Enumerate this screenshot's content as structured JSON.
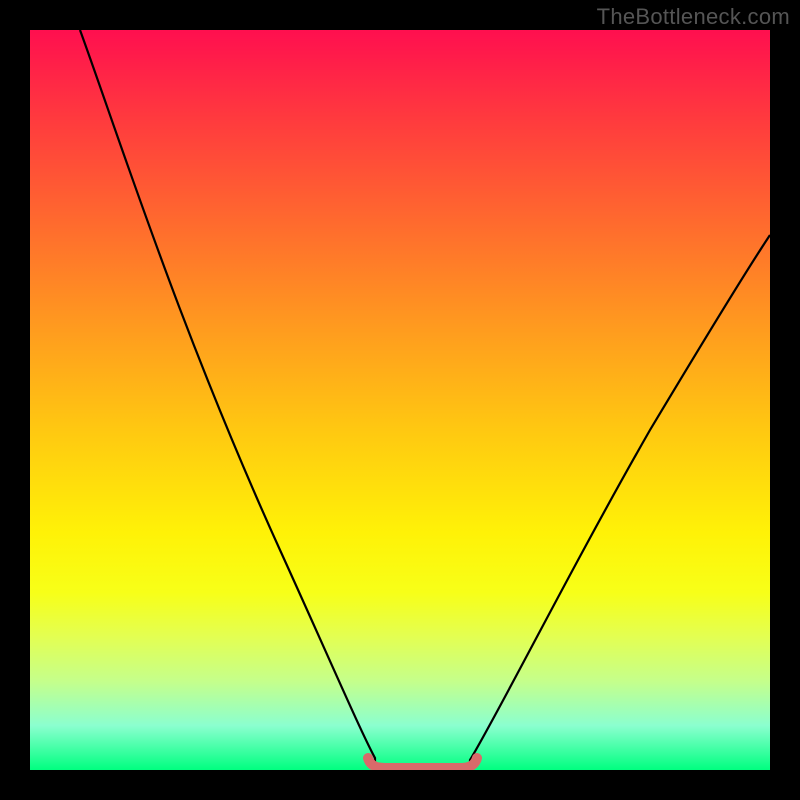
{
  "watermark": "TheBottleneck.com",
  "chart_data": {
    "type": "line",
    "title": "",
    "xlabel": "",
    "ylabel": "",
    "xlim": [
      0,
      100
    ],
    "ylim": [
      0,
      100
    ],
    "series": [
      {
        "name": "bottleneck-curve",
        "x": [
          0,
          5,
          10,
          15,
          20,
          25,
          30,
          35,
          40,
          45,
          50,
          55,
          60,
          65,
          70,
          75,
          80,
          85,
          90,
          95,
          100
        ],
        "y": [
          100,
          88,
          76,
          65,
          54,
          43,
          32,
          22,
          12,
          4,
          0,
          0,
          0,
          5,
          12,
          20,
          29,
          38,
          47,
          55,
          62
        ]
      }
    ],
    "annotations": [
      {
        "name": "flat-zone-marker",
        "x_range": [
          45,
          62
        ],
        "y": 0
      }
    ],
    "background": {
      "type": "vertical-gradient",
      "stops": [
        {
          "pos": 0,
          "color": "#ff0f4f"
        },
        {
          "pos": 12,
          "color": "#ff3a3e"
        },
        {
          "pos": 26,
          "color": "#ff6a2e"
        },
        {
          "pos": 40,
          "color": "#ff9a1f"
        },
        {
          "pos": 54,
          "color": "#ffc811"
        },
        {
          "pos": 68,
          "color": "#fff207"
        },
        {
          "pos": 76,
          "color": "#f7ff18"
        },
        {
          "pos": 82,
          "color": "#e3ff52"
        },
        {
          "pos": 88,
          "color": "#c5ff8b"
        },
        {
          "pos": 94,
          "color": "#8bffcf"
        },
        {
          "pos": 100,
          "color": "#00ff80"
        }
      ]
    }
  }
}
